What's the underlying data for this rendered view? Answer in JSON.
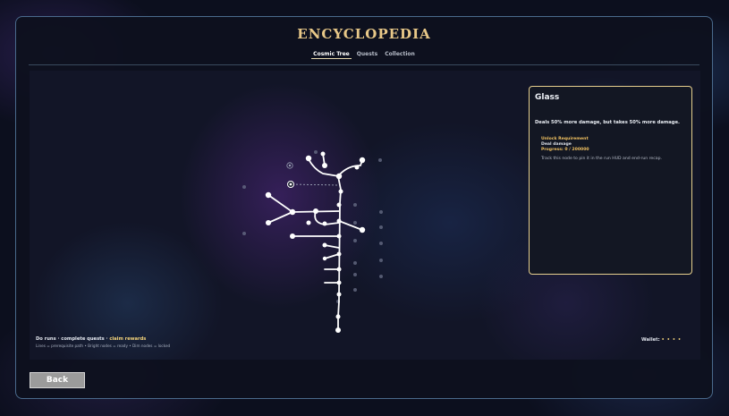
{
  "window": {
    "title": "ENCYCLOPEDIA"
  },
  "tabs": [
    {
      "label": "Cosmic Tree",
      "active": true
    },
    {
      "label": "Quests",
      "active": false
    },
    {
      "label": "Collection",
      "active": false
    }
  ],
  "info_panel": {
    "name": "Glass",
    "description": "Deals 50% more damage, but takes 50% more damage.",
    "unlock_heading": "Unlock Requirement",
    "unlock_condition": "Deal damage",
    "unlock_progress": "Progress: 0 / 200000",
    "tip": "Track this node to pin it in the run HUD and end-run recap."
  },
  "footer": {
    "hint_prefix": "Do runs · complete quests · ",
    "hint_highlight": "claim rewards",
    "legend": "Lines = prerequisite path • Bright nodes = ready • Dim nodes = locked",
    "wallet_label": "Wallet:",
    "wallet_value": "• • • •"
  },
  "back_button": {
    "label": "Back"
  },
  "colors": {
    "accent_gold": "#e8c888",
    "panel_border": "#e6cf8e",
    "window_border": "#4a6a8c"
  }
}
